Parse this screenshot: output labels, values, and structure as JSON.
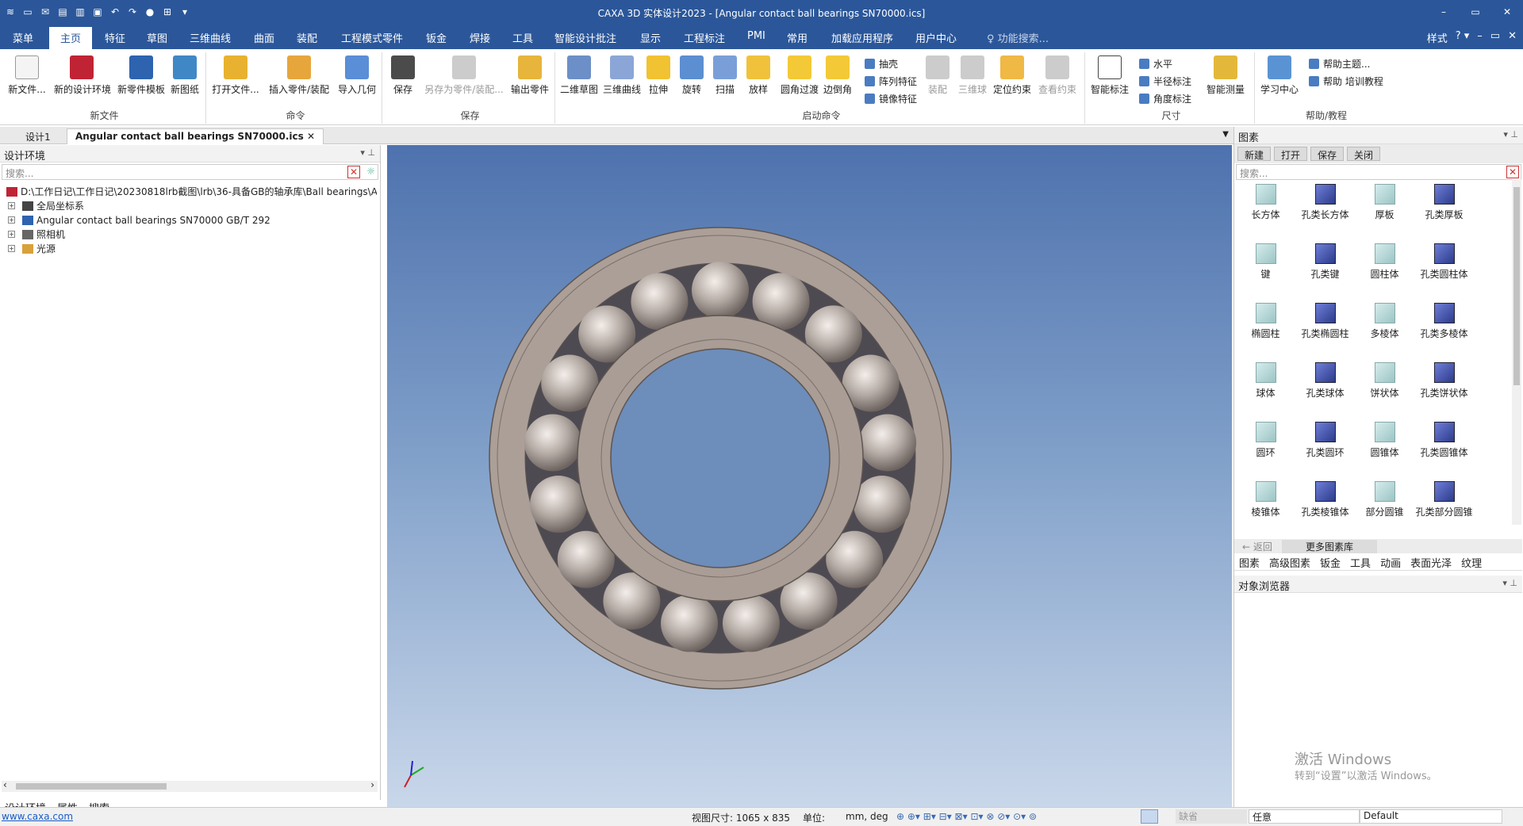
{
  "window": {
    "title": "CAXA 3D 实体设计2023 - [Angular contact ball bearings SN70000.ics]",
    "controls": [
      "–",
      "▭",
      "✕"
    ]
  },
  "menubar": {
    "items": [
      "菜单",
      "主页",
      "特征",
      "草图",
      "三维曲线",
      "曲面",
      "装配",
      "工程模式零件",
      "钣金",
      "焊接",
      "工具",
      "智能设计批注",
      "显示",
      "工程标注",
      "PMI",
      "常用",
      "加载应用程序",
      "用户中心"
    ],
    "search": "功能搜索...",
    "style": "样式"
  },
  "ribbon": {
    "new_file": {
      "label": "新文件",
      "buttons": [
        "新文件...",
        "新的设计环境",
        "新零件模板",
        "新图纸"
      ]
    },
    "command": {
      "label": "命令",
      "buttons": [
        "打开文件...",
        "插入零件/装配",
        "导入几何"
      ]
    },
    "save": {
      "label": "保存",
      "buttons": [
        "保存",
        "另存为零件/装配...",
        "输出零件"
      ]
    },
    "launch": {
      "label": "启动命令",
      "buttons": [
        "二维草图",
        "三维曲线",
        "拉伸",
        "旋转",
        "扫描",
        "放样",
        "圆角过渡",
        "边倒角"
      ],
      "small": [
        "抽壳",
        "阵列特征",
        "镜像特征"
      ],
      "disabled": [
        "装配",
        "三维球",
        "查看约束"
      ],
      "constraint": "定位约束"
    },
    "dimension": {
      "label": "尺寸",
      "smart": "智能标注",
      "small": [
        "水平",
        "半径标注",
        "角度标注"
      ],
      "measure": "智能测量"
    },
    "help": {
      "label": "帮助/教程",
      "learn": "学习中心",
      "small": [
        "帮助主题...",
        "帮助 培训教程"
      ]
    }
  },
  "doctabs": [
    "设计1",
    "Angular contact ball bearings SN70000.ics"
  ],
  "left": {
    "title": "设计环境",
    "search": "搜索...",
    "tree": [
      "D:\\工作日记\\工作日记\\20230818lrb截图\\lrb\\36-具备GB的轴承库\\Ball bearings\\An",
      "全局坐标系",
      "Angular contact ball bearings SN70000 GB/T 292",
      "照相机",
      "光源"
    ],
    "tabs": [
      "设计环境",
      "属性",
      "搜索"
    ]
  },
  "right": {
    "title": "图素",
    "tools": [
      "新建",
      "打开",
      "保存",
      "关闭"
    ],
    "search": "搜索...",
    "items": [
      "长方体",
      "孔类长方体",
      "厚板",
      "孔类厚板",
      "键",
      "孔类键",
      "圆柱体",
      "孔类圆柱体",
      "椭圆柱",
      "孔类椭圆柱",
      "多棱体",
      "孔类多棱体",
      "球体",
      "孔类球体",
      "饼状体",
      "孔类饼状体",
      "圆环",
      "孔类圆环",
      "圆锥体",
      "孔类圆锥体",
      "棱锥体",
      "孔类棱锥体",
      "部分圆锥",
      "孔类部分圆锥"
    ],
    "back": "返回",
    "more": "更多图素库",
    "tabs": [
      "图素",
      "高级图素",
      "钣金",
      "工具",
      "动画",
      "表面光泽",
      "纹理"
    ],
    "browser": "对象浏览器",
    "watermark1": "激活 Windows",
    "watermark2": "转到“设置”以激活 Windows。"
  },
  "status": {
    "link": "www.caxa.com",
    "view_size": "视图尺寸: 1065 x  835",
    "unit_label": "单位:",
    "unit": "mm, deg",
    "filter1": "缺省",
    "filter2": "任意",
    "filter3": "Default"
  }
}
